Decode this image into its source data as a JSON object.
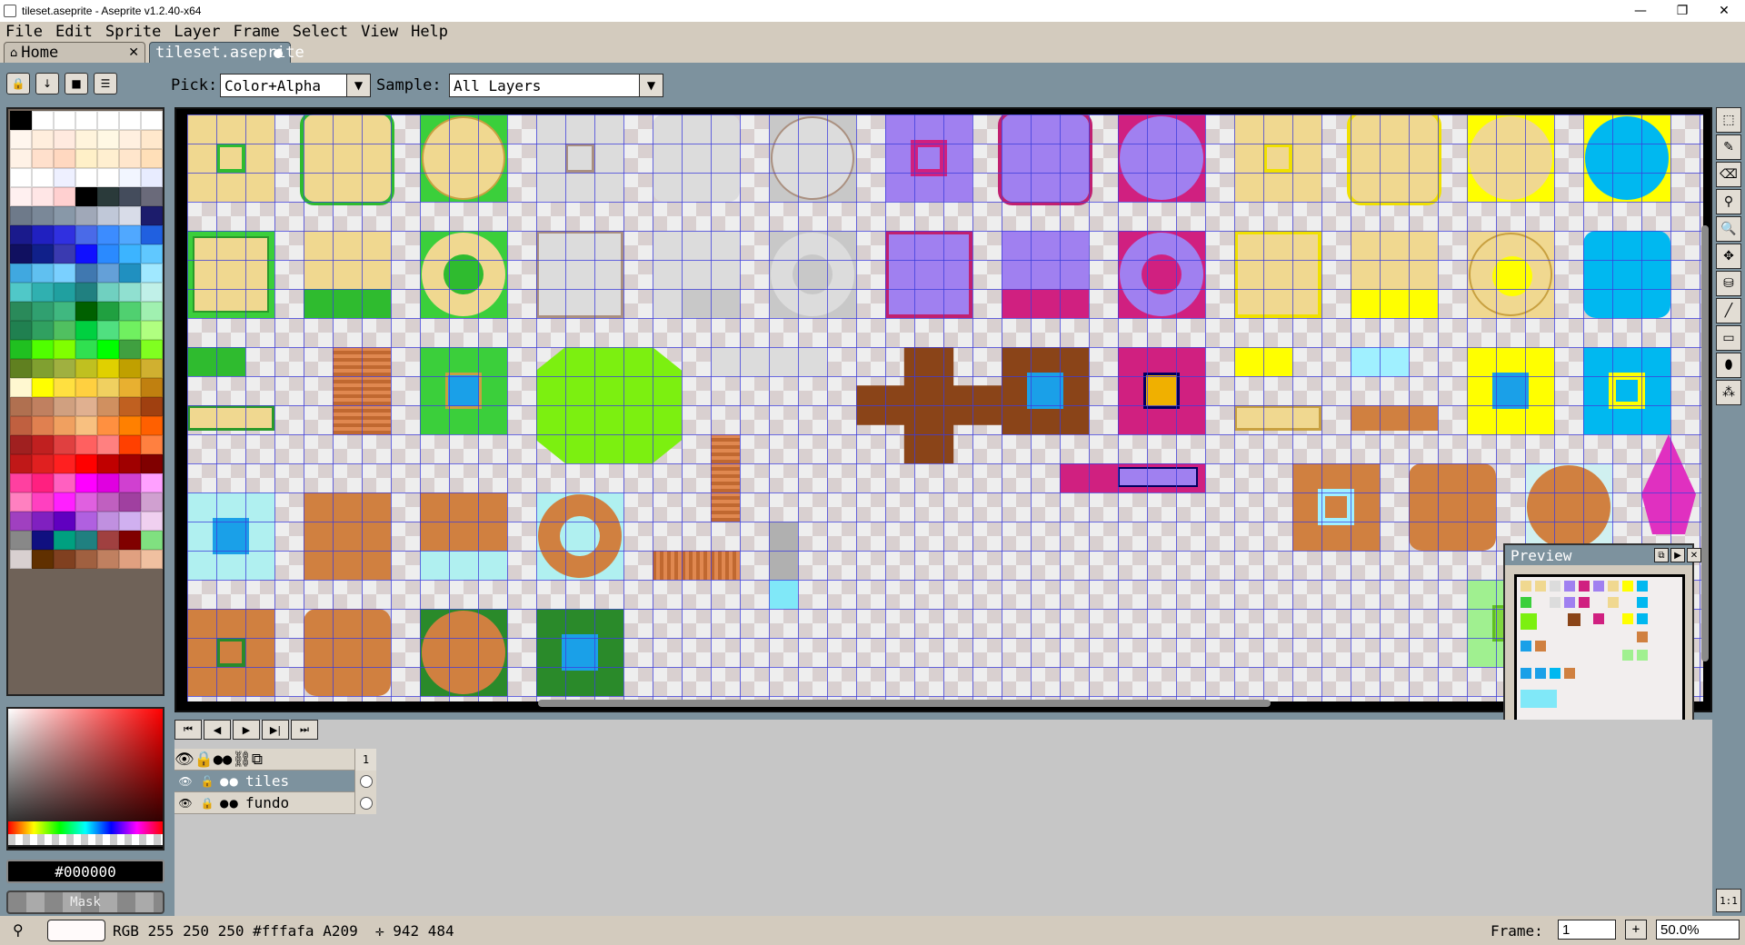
{
  "window": {
    "title": "tileset.aseprite - Aseprite v1.2.40-x64"
  },
  "menu": [
    "File",
    "Edit",
    "Sprite",
    "Layer",
    "Frame",
    "Select",
    "View",
    "Help"
  ],
  "tabs": {
    "home": "Home",
    "file": "tileset.aseprite"
  },
  "context_bar": {
    "pick_label": "Pick:",
    "pick_value": "Color+Alpha",
    "sample_label": "Sample:",
    "sample_value": "All Layers"
  },
  "palette": [
    "#000000",
    "#ffffff",
    "#ffffff",
    "#ffffff",
    "#ffffff",
    "#ffffff",
    "#ffffff",
    "#fff6ee",
    "#ffeedd",
    "#ffeadf",
    "#fff4dc",
    "#fff8e4",
    "#fff0e0",
    "#ffe8cc",
    "#fff2e6",
    "#ffe0cc",
    "#ffd8c0",
    "#fff0c8",
    "#ffefd0",
    "#ffe6cc",
    "#ffdfb8",
    "#ffffff",
    "#ffffff",
    "#eef0ff",
    "#ffffff",
    "#ffffff",
    "#f2f6ff",
    "#e8ecff",
    "#fff0f0",
    "#ffe6e6",
    "#ffd0d0",
    "#000000",
    "#2a3a3a",
    "#444c5c",
    "#6a6a7a",
    "#6e7a8a",
    "#7a8898",
    "#8898a8",
    "#a0a8b8",
    "#c0c8d8",
    "#d8dce8",
    "#1c1c6c",
    "#1a1a8c",
    "#2020c0",
    "#3030e0",
    "#4a6ae8",
    "#3c8cff",
    "#50a8ff",
    "#2060e0",
    "#101060",
    "#10208a",
    "#3a3ab0",
    "#1010ff",
    "#2a8aff",
    "#3cb4ff",
    "#60c8ff",
    "#40a8e0",
    "#60c0f0",
    "#7ad0ff",
    "#4078b0",
    "#64a0d8",
    "#2090c0",
    "#a0e8ff",
    "#50c8c8",
    "#30b0b0",
    "#20a0a0",
    "#208080",
    "#70d0c0",
    "#90e0d0",
    "#c0f0e8",
    "#2a8a5a",
    "#30a070",
    "#40b880",
    "#006000",
    "#20a040",
    "#50d070",
    "#a0f0b0",
    "#208050",
    "#30a060",
    "#50c060",
    "#00d040",
    "#50e080",
    "#70f060",
    "#b0ff80",
    "#20c020",
    "#50ff00",
    "#80ff00",
    "#30e050",
    "#00ff00",
    "#40a040",
    "#80ff20",
    "#608020",
    "#80a030",
    "#a0b040",
    "#c0c020",
    "#e0d000",
    "#c0a000",
    "#d0b030",
    "#fff8d0",
    "#ffff00",
    "#ffe040",
    "#ffd040",
    "#f0d060",
    "#e8b030",
    "#c08010",
    "#b07050",
    "#c08060",
    "#d0a080",
    "#e0b090",
    "#d09060",
    "#c06020",
    "#a04010",
    "#c06040",
    "#e08050",
    "#f0a060",
    "#f8c080",
    "#ff9040",
    "#ff8000",
    "#ff6000",
    "#a02020",
    "#c02020",
    "#e04040",
    "#ff6060",
    "#ff8080",
    "#ff4000",
    "#ff8040",
    "#c01818",
    "#e02020",
    "#ff2020",
    "#ff0000",
    "#c00000",
    "#a00000",
    "#800000",
    "#ff40a0",
    "#ff2080",
    "#ff60c0",
    "#ff00ff",
    "#e000e0",
    "#d040d0",
    "#ffa0ff",
    "#ff80c0",
    "#ff40c0",
    "#ff20ff",
    "#e060e0",
    "#c060c0",
    "#a040a0",
    "#d0a0d0",
    "#a040c0",
    "#8020c0",
    "#6000c0",
    "#b060e0",
    "#c090e0",
    "#d0b0f0",
    "#f0d0f0",
    "#888888",
    "#101080",
    "#00a080",
    "#208080",
    "#a04040",
    "#800000",
    "#80e080",
    "#d8d0d0",
    "#603000",
    "#804020",
    "#a06040",
    "#c08060",
    "#e0a080",
    "#f0c0a0"
  ],
  "color_bar": {
    "hex": "#000000",
    "mask": "Mask"
  },
  "preview": {
    "title": "Preview"
  },
  "layers": [
    {
      "name": "tiles",
      "selected": true
    },
    {
      "name": "fundo",
      "selected": false
    }
  ],
  "timeline": {
    "frame_header": "1"
  },
  "status": {
    "pixel_info": "RGB 255 250 250 #fffafa A209  ✛ 942 484",
    "frame_label": "Frame:",
    "frame_value": "1",
    "zoom_value": "50.0%"
  }
}
